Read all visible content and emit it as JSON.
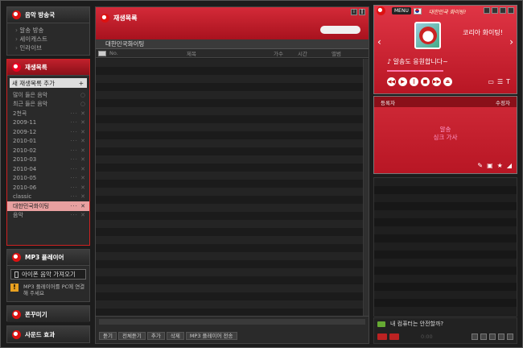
{
  "sidebar": {
    "broadcast": {
      "title": "음악 방송국",
      "items": [
        "알송 방송",
        "세이캐스트",
        "인라이브"
      ]
    },
    "playlist": {
      "title": "재생목록",
      "add_label": "새 재생목록 추가",
      "items": [
        {
          "label": "많이 들은 음악",
          "selected": false
        },
        {
          "label": "최근 들은 음악",
          "selected": false
        },
        {
          "label": "2천곡",
          "selected": false
        },
        {
          "label": "2009-11",
          "selected": false
        },
        {
          "label": "2009-12",
          "selected": false
        },
        {
          "label": "2010-01",
          "selected": false
        },
        {
          "label": "2010-02",
          "selected": false
        },
        {
          "label": "2010-03",
          "selected": false
        },
        {
          "label": "2010-04",
          "selected": false
        },
        {
          "label": "2010-05",
          "selected": false
        },
        {
          "label": "2010-06",
          "selected": false
        },
        {
          "label": "classic",
          "selected": false
        },
        {
          "label": "대한민국화이팅",
          "selected": true
        },
        {
          "label": "음악",
          "selected": false
        }
      ]
    },
    "mp3": {
      "title": "MP3 플레이어",
      "iphone_label": "아이폰 음악 가져오기",
      "info": "MP3 플레이어를 PC에 연결해 주세요"
    },
    "phone": {
      "title": "폰꾸미기"
    },
    "sound": {
      "title": "사운드 효과"
    }
  },
  "center": {
    "title": "재생목록",
    "playlist_name": "대한민국화이팅",
    "columns": [
      "No.",
      "제목",
      "가수",
      "시간",
      "앨범"
    ],
    "buttons": [
      "듣기",
      "전체듣기",
      "추가",
      "삭제",
      "MP3 플레이어 전송"
    ]
  },
  "player": {
    "menu_label": "MENU",
    "title": "대한민국 화이팅!",
    "song": "코리아 화이팅!",
    "now_playing": "알송도 응원합니다~"
  },
  "lyrics": {
    "left_label": "등록자",
    "right_label": "수정자",
    "line1": "알송",
    "line2": "싱크 가사"
  },
  "status": {
    "safety": "내 컴퓨터는 안전할까?",
    "time": "0:00"
  },
  "colors": {
    "accent": "#d42a38",
    "selected_row": "#e8a0a0"
  }
}
